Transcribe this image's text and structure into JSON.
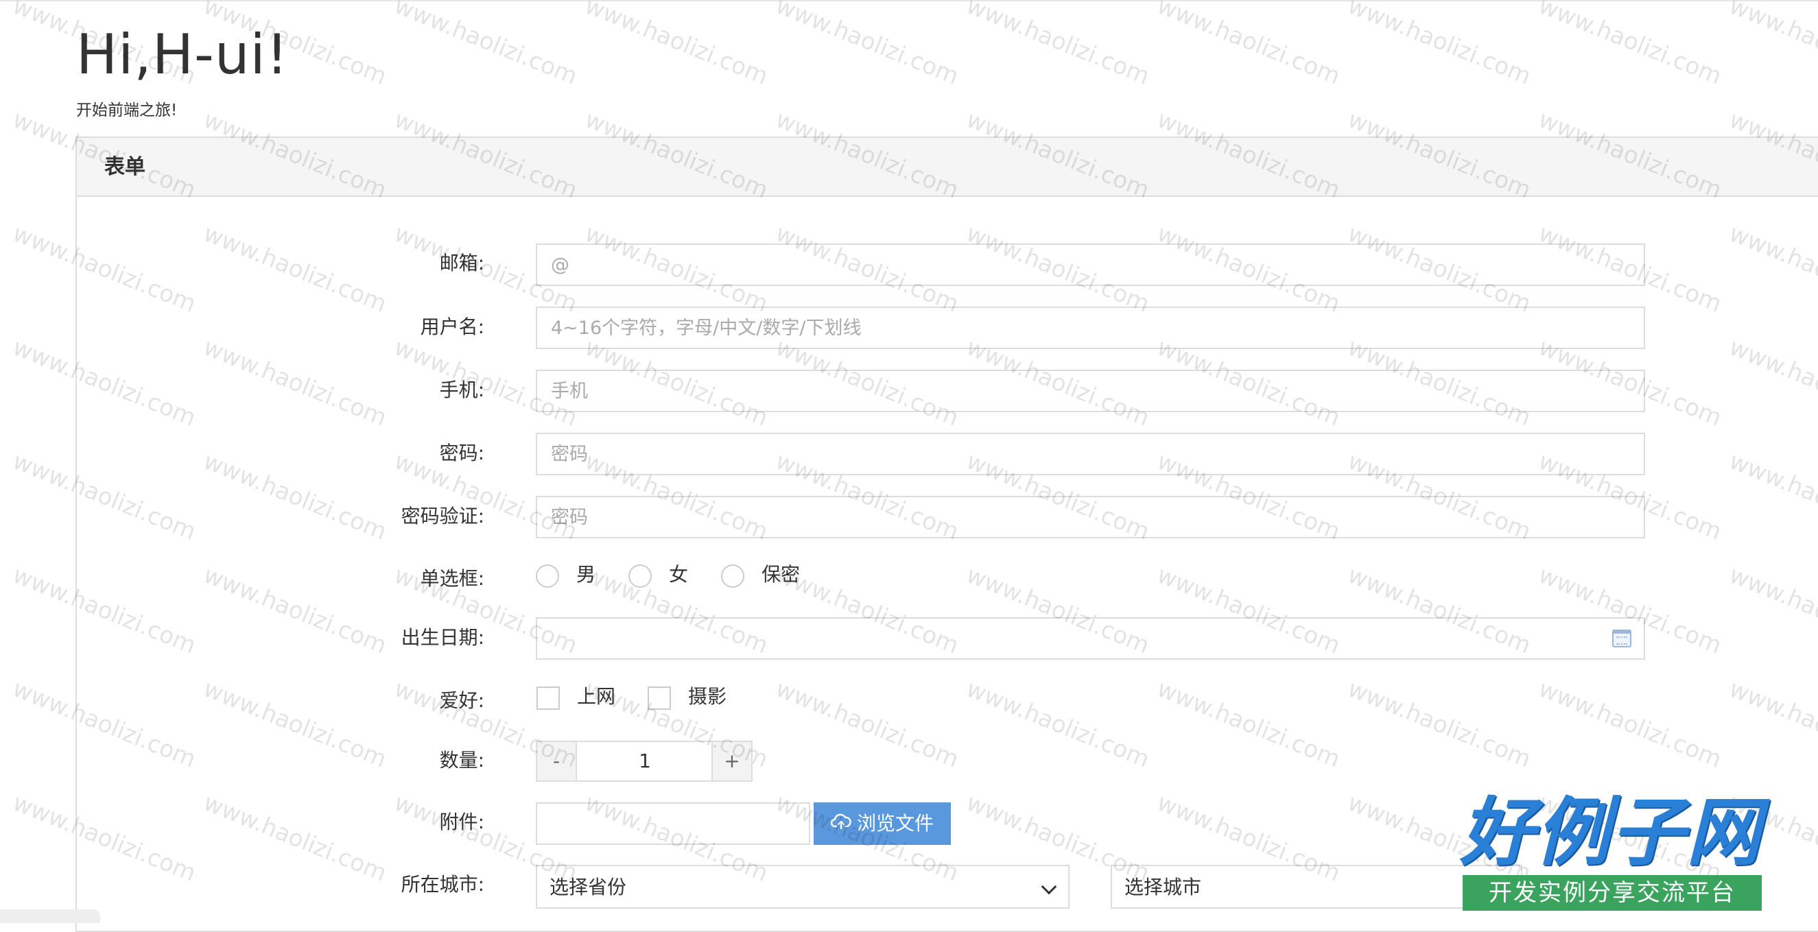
{
  "hero": {
    "title": "Hi,H-ui!",
    "subtitle": "开始前端之旅!"
  },
  "panel": {
    "title": "表单"
  },
  "form": {
    "email": {
      "label": "邮箱:",
      "placeholder": "@"
    },
    "username": {
      "label": "用户名:",
      "placeholder": "4~16个字符，字母/中文/数字/下划线"
    },
    "phone": {
      "label": "手机:",
      "placeholder": "手机"
    },
    "password": {
      "label": "密码:",
      "placeholder": "密码"
    },
    "password_confirm": {
      "label": "密码验证:",
      "placeholder": "密码"
    },
    "radio": {
      "label": "单选框:",
      "options": [
        "男",
        "女",
        "保密"
      ]
    },
    "birthday": {
      "label": "出生日期:",
      "value": ""
    },
    "hobby": {
      "label": "爱好:",
      "options": [
        "上网",
        "摄影"
      ]
    },
    "quantity": {
      "label": "数量:",
      "minus": "-",
      "value": "1",
      "plus": "+"
    },
    "attachment": {
      "label": "附件:",
      "button": "浏览文件"
    },
    "city": {
      "label": "所在城市:",
      "province_selected": "选择省份",
      "city_selected": "选择城市"
    }
  },
  "watermark": {
    "text": "www.haolizi.com"
  },
  "brand": {
    "name": "好例子网",
    "slogan": "开发实例分享交流平台"
  },
  "colors": {
    "accent": "#5a98de",
    "brand_blue": "#2a7fd6",
    "brand_green": "#3aa35d"
  }
}
